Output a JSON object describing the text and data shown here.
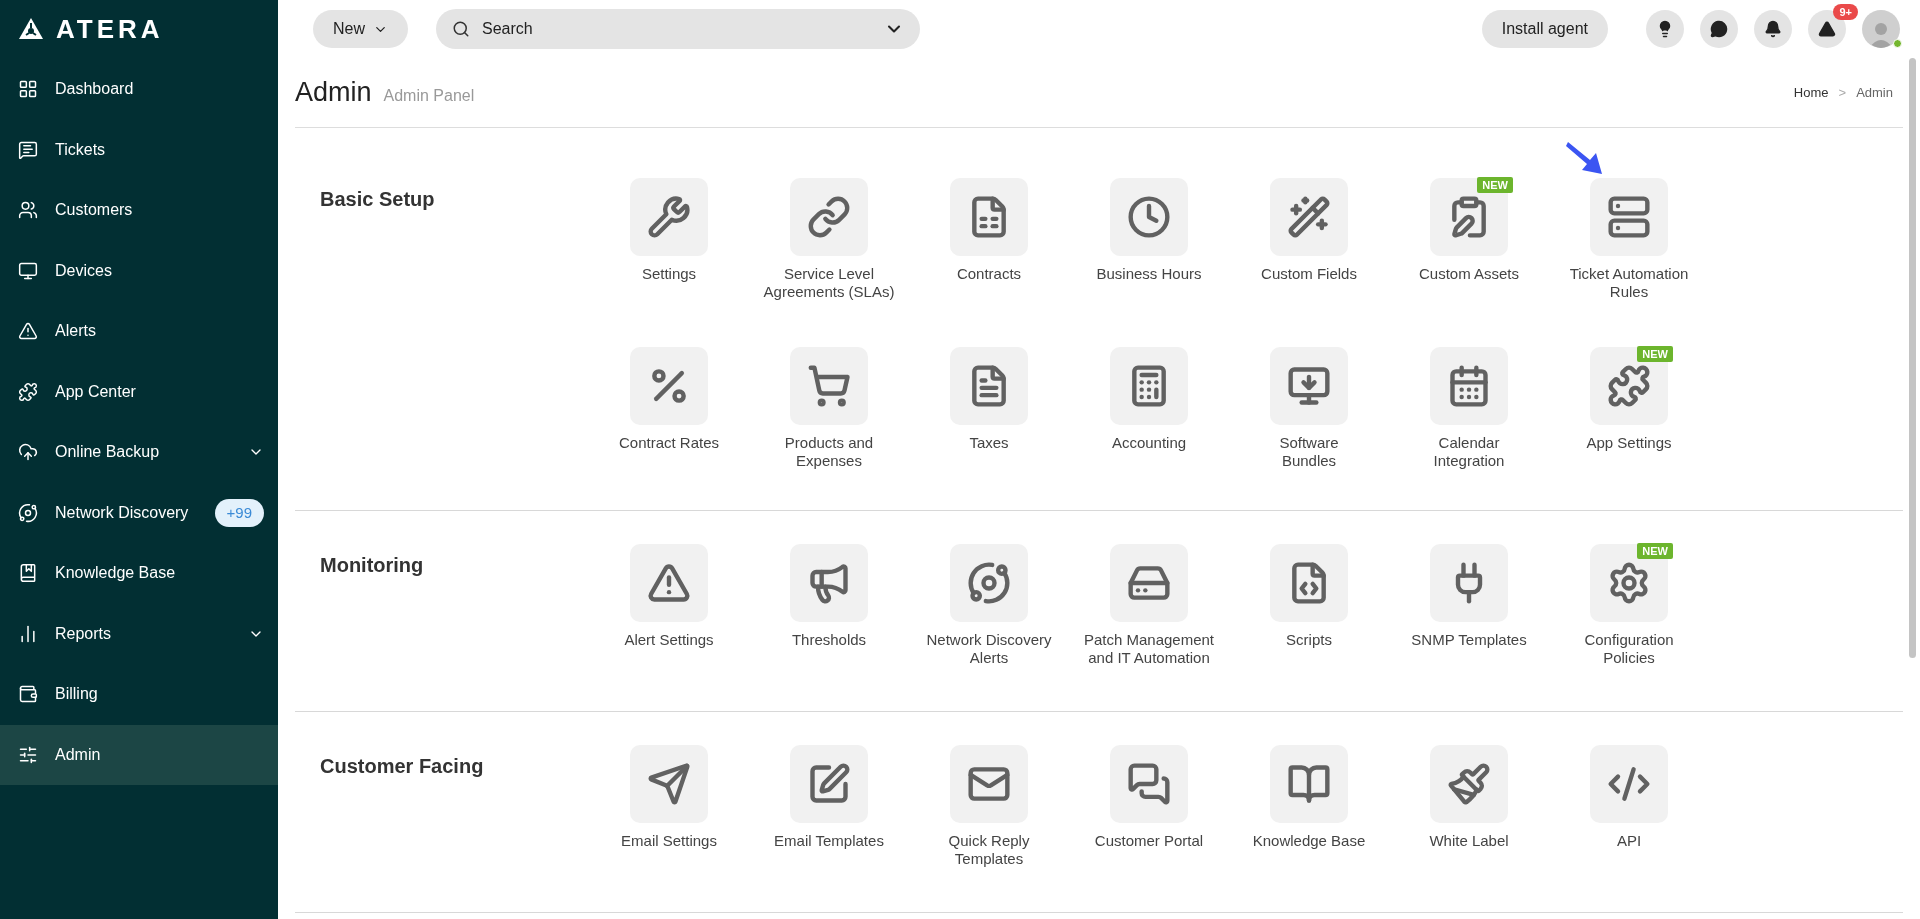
{
  "brand": {
    "name": "ATERA"
  },
  "sidebar": {
    "items": [
      {
        "label": "Dashboard",
        "selected": false,
        "submenu": false
      },
      {
        "label": "Tickets",
        "selected": false,
        "submenu": false
      },
      {
        "label": "Customers",
        "selected": false,
        "submenu": false
      },
      {
        "label": "Devices",
        "selected": false,
        "submenu": false
      },
      {
        "label": "Alerts",
        "selected": false,
        "submenu": false
      },
      {
        "label": "App Center",
        "selected": false,
        "submenu": false
      },
      {
        "label": "Online Backup",
        "selected": false,
        "submenu": true
      },
      {
        "label": "Network Discovery",
        "selected": false,
        "submenu": false,
        "badge": "+99"
      },
      {
        "label": "Knowledge Base",
        "selected": false,
        "submenu": false
      },
      {
        "label": "Reports",
        "selected": false,
        "submenu": true
      },
      {
        "label": "Billing",
        "selected": false,
        "submenu": false
      },
      {
        "label": "Admin",
        "selected": true,
        "submenu": false
      }
    ]
  },
  "topbar": {
    "new_button": "New",
    "search": {
      "placeholder": "Search"
    },
    "install_button": "Install agent",
    "alerts_badge": "9+",
    "user_online": true
  },
  "header": {
    "title": "Admin",
    "subtitle": "Admin Panel",
    "breadcrumb": [
      "Home",
      "Admin"
    ],
    "separator": ">"
  },
  "sections": [
    {
      "title": "Basic Setup",
      "items": [
        {
          "label": "Settings"
        },
        {
          "label": "Service Level\nAgreements (SLAs)"
        },
        {
          "label": "Contracts"
        },
        {
          "label": "Business Hours"
        },
        {
          "label": "Custom Fields"
        },
        {
          "label": "Custom Assets",
          "badge": "NEW"
        },
        {
          "label": "Ticket Automation\nRules",
          "pointer": true
        },
        {
          "label": "Contract Rates"
        },
        {
          "label": "Products and\nExpenses"
        },
        {
          "label": "Taxes"
        },
        {
          "label": "Accounting"
        },
        {
          "label": "Software\nBundles"
        },
        {
          "label": "Calendar\nIntegration"
        },
        {
          "label": "App Settings",
          "badge": "NEW"
        }
      ]
    },
    {
      "title": "Monitoring",
      "items": [
        {
          "label": "Alert Settings"
        },
        {
          "label": "Thresholds"
        },
        {
          "label": "Network Discovery\nAlerts"
        },
        {
          "label": "Patch Management\nand IT Automation"
        },
        {
          "label": "Scripts"
        },
        {
          "label": "SNMP Templates"
        },
        {
          "label": "Configuration\nPolicies",
          "badge": "NEW"
        }
      ]
    },
    {
      "title": "Customer Facing",
      "items": [
        {
          "label": "Email Settings"
        },
        {
          "label": "Email Templates"
        },
        {
          "label": "Quick Reply\nTemplates"
        },
        {
          "label": "Customer Portal"
        },
        {
          "label": "Knowledge Base"
        },
        {
          "label": "White Label"
        },
        {
          "label": "API"
        }
      ]
    }
  ]
}
